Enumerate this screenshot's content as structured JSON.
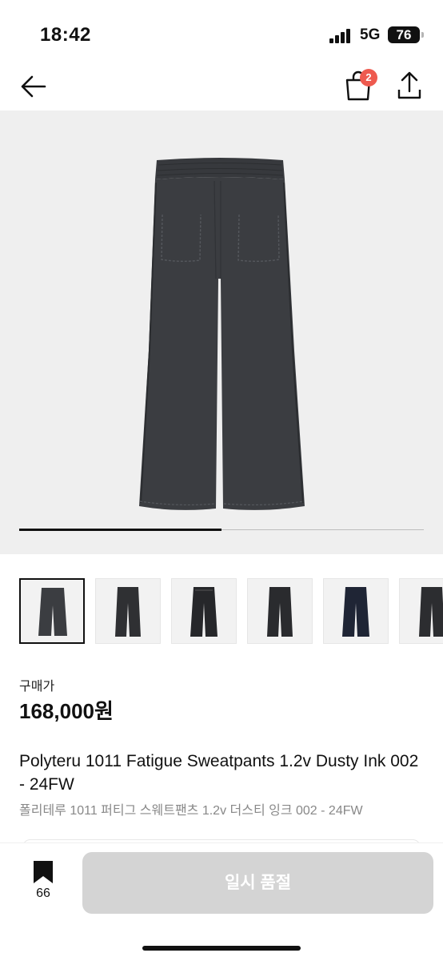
{
  "status_bar": {
    "time": "18:42",
    "network": "5G",
    "battery": "76"
  },
  "nav": {
    "cart_badge": "2",
    "icons": [
      "arrow-left-icon",
      "shopping-bag-icon",
      "share-icon"
    ]
  },
  "gallery": {
    "progress": 0.5,
    "thumbnail_count": 6,
    "selected_index": 0,
    "colors": {
      "background": "#efefef",
      "product": "#3b3d41"
    }
  },
  "product": {
    "price_label": "구매가",
    "price": "168,000원",
    "title_en": "Polyteru 1011 Fatigue Sweatpants 1.2v Dusty Ink 002 - 24FW",
    "title_ko": "폴리테루 1011 퍼티그 스웨트팬츠 1.2v 더스티 잉크 002 - 24FW"
  },
  "bottom_bar": {
    "bookmark_count": "66",
    "action_label": "일시 품절",
    "action_color": "#d4d4d4"
  }
}
